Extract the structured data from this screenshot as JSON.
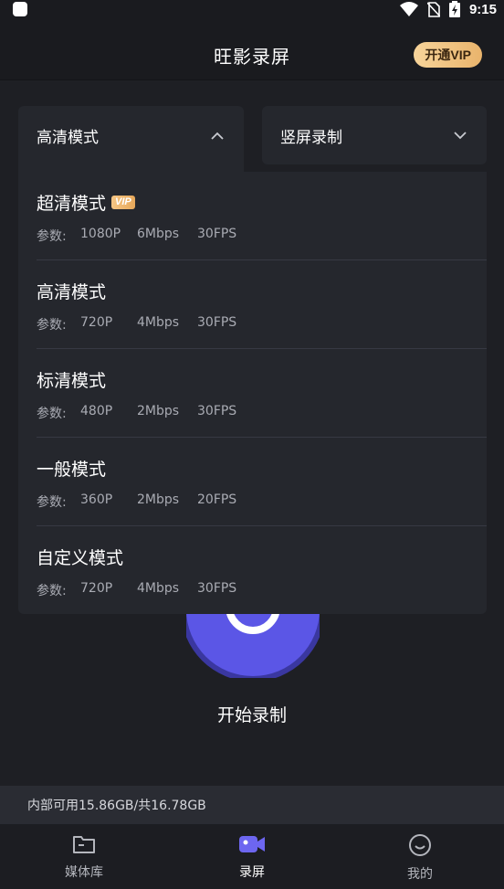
{
  "status_bar": {
    "time": "9:15",
    "icons": [
      "app-square-icon",
      "wifi-icon",
      "no-sim-icon",
      "battery-charging-icon"
    ]
  },
  "header": {
    "title": "旺影录屏",
    "vip_button": "开通VIP"
  },
  "quality_dropdown": {
    "selected": "高清模式",
    "expanded": true,
    "chevron": "chevron-up-icon"
  },
  "orientation_dropdown": {
    "selected": "竖屏录制",
    "expanded": false,
    "chevron": "chevron-down-icon"
  },
  "quality_options": [
    {
      "title": "超清模式",
      "vip_badge": "VIP",
      "param_label": "参数:",
      "resolution": "1080P",
      "bitrate": "6Mbps",
      "fps": "30FPS"
    },
    {
      "title": "高清模式",
      "vip_badge": "",
      "param_label": "参数:",
      "resolution": "720P",
      "bitrate": "4Mbps",
      "fps": "30FPS"
    },
    {
      "title": "标清模式",
      "vip_badge": "",
      "param_label": "参数:",
      "resolution": "480P",
      "bitrate": "2Mbps",
      "fps": "30FPS"
    },
    {
      "title": "一般模式",
      "vip_badge": "",
      "param_label": "参数:",
      "resolution": "360P",
      "bitrate": "2Mbps",
      "fps": "20FPS"
    },
    {
      "title": "自定义模式",
      "vip_badge": "",
      "param_label": "参数:",
      "resolution": "720P",
      "bitrate": "4Mbps",
      "fps": "30FPS"
    }
  ],
  "record": {
    "label": "开始录制"
  },
  "storage": {
    "text": "内部可用15.86GB/共16.78GB"
  },
  "bottom_nav": {
    "items": [
      {
        "label": "媒体库",
        "icon": "folder-icon",
        "active": false
      },
      {
        "label": "录屏",
        "icon": "video-camera-icon",
        "active": true
      },
      {
        "label": "我的",
        "icon": "smiley-icon",
        "active": false
      }
    ]
  },
  "colors": {
    "background": "#1a1b1f",
    "panel": "#25272d",
    "accent": "#5b56e6",
    "vip_gold": "#e9b46c"
  }
}
